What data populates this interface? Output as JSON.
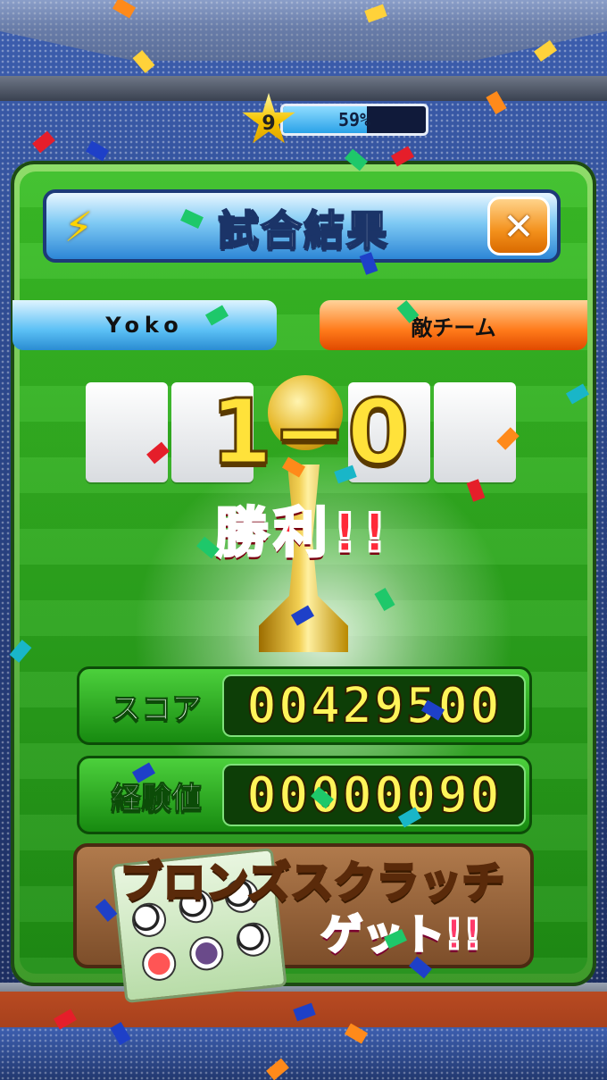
{
  "player": {
    "level": "9",
    "exp_percent_label": "59%",
    "exp_fraction": 0.59
  },
  "dialog": {
    "title": "試合結果",
    "close_label": "✕",
    "bolt_icon": "⚡"
  },
  "teams": {
    "home": "Yoko",
    "away": "敵チーム"
  },
  "match": {
    "score": "1−0",
    "result": "勝利!!"
  },
  "stats": {
    "score_label": "スコア",
    "score_value": "00429500",
    "exp_label": "経験値",
    "exp_value": "00000090"
  },
  "reward": {
    "title": "ブロンズスクラッチ",
    "subtitle": "ゲット!!"
  },
  "colors": {
    "accent_green": "#2aa81c",
    "title_blue": "#2d86d6",
    "win_red": "#ff2a3a"
  }
}
